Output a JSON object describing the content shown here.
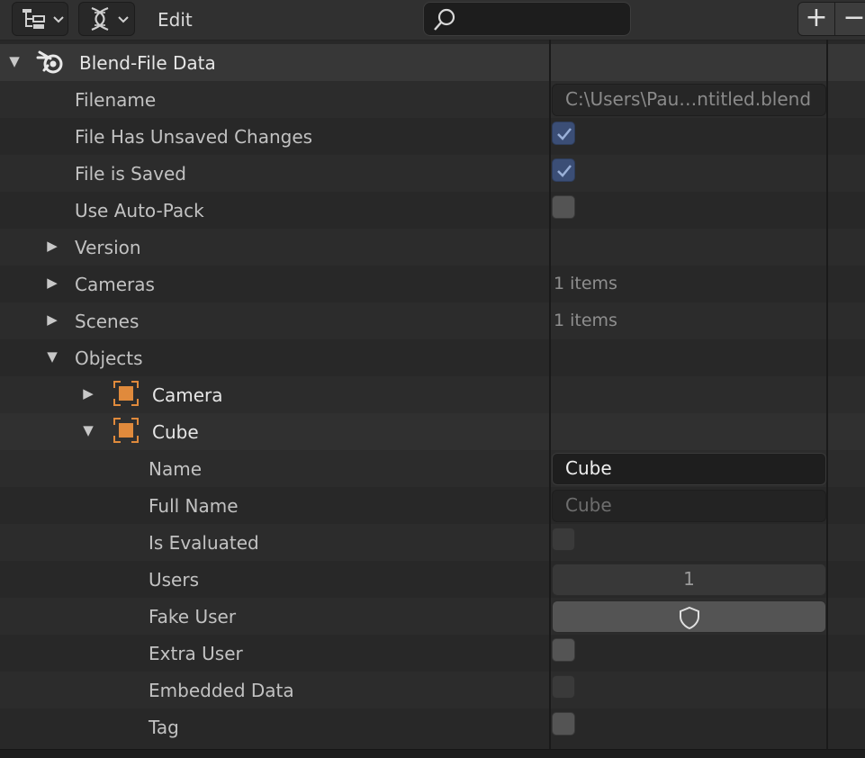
{
  "header": {
    "display_mode_icon": "outliner-tree-icon",
    "filter_icon": "dna-filter-icon",
    "mode_label": "Edit",
    "search": {
      "value": "",
      "placeholder": ""
    },
    "add_label": "+",
    "remove_label": "−"
  },
  "tree": {
    "root": {
      "label": "Blend-File Data",
      "icon": "blender-logo-icon",
      "expanded": true
    },
    "filename": {
      "label": "Filename",
      "value": "C:\\Users\\Pau…ntitled.blend"
    },
    "unsaved": {
      "label": "File Has Unsaved Changes",
      "checked": true
    },
    "saved": {
      "label": "File is Saved",
      "checked": true
    },
    "autopack": {
      "label": "Use Auto-Pack",
      "checked": false
    },
    "version": {
      "label": "Version",
      "expanded": false
    },
    "cameras": {
      "label": "Cameras",
      "expanded": false,
      "value": "1 items"
    },
    "scenes": {
      "label": "Scenes",
      "expanded": false,
      "value": "1 items"
    },
    "objects": {
      "label": "Objects",
      "expanded": true
    },
    "camera_obj": {
      "label": "Camera",
      "expanded": false,
      "icon": "object-icon"
    },
    "cube_obj": {
      "label": "Cube",
      "expanded": true,
      "icon": "object-icon"
    },
    "cube_props": {
      "name": {
        "label": "Name",
        "value": "Cube"
      },
      "full_name": {
        "label": "Full Name",
        "value": "Cube"
      },
      "is_evaluated": {
        "label": "Is Evaluated",
        "checked": false
      },
      "users": {
        "label": "Users",
        "value": "1"
      },
      "fake_user": {
        "label": "Fake User",
        "icon": "shield-icon"
      },
      "extra_user": {
        "label": "Extra User",
        "checked": false
      },
      "embedded": {
        "label": "Embedded Data",
        "checked": false
      },
      "tag": {
        "label": "Tag",
        "checked": false
      }
    }
  },
  "colors": {
    "background": "#282828",
    "header": "#303030",
    "checkbox_checked": "#3b4e76",
    "object_icon": "#e08a3c"
  }
}
